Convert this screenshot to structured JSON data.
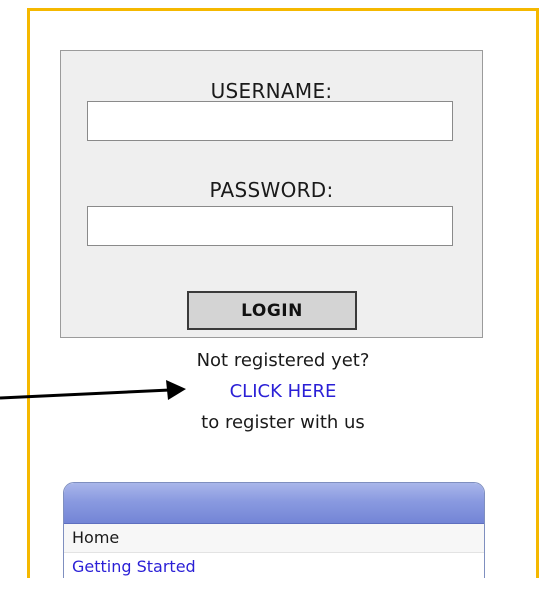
{
  "login": {
    "username_label": "USERNAME:",
    "username_value": "",
    "password_label": "PASSWORD:",
    "password_value": "",
    "button_label": "LOGIN"
  },
  "register": {
    "line1": "Not registered yet?",
    "link_text": "CLICK HERE",
    "line3": "to register with us"
  },
  "menu": {
    "items": [
      {
        "label": "Home"
      },
      {
        "label": "Getting Started"
      }
    ]
  },
  "colors": {
    "frame_border": "#f5b800",
    "link": "#2a1fd6",
    "menu_header": "#8a9ae0",
    "panel_background": "#efefef"
  },
  "icons": {
    "arrow": "right-arrow-pointer"
  }
}
